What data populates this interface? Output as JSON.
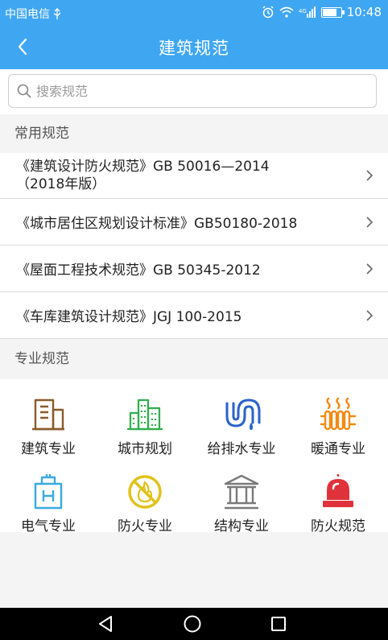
{
  "status": {
    "carrier": "中国电信",
    "time": "10:48"
  },
  "nav": {
    "title": "建筑规范"
  },
  "search": {
    "placeholder": "搜索规范"
  },
  "common": {
    "title": "常用规范",
    "items": [
      {
        "line1": "《建筑设计防火规范》GB 50016—2014",
        "line2": "（2018年版）"
      },
      {
        "line1": "《城市居住区规划设计标准》GB50180-2018"
      },
      {
        "line1": "《屋面工程技术规范》GB 50345-2012"
      },
      {
        "line1": "《车库建筑设计规范》JGJ 100-2015"
      }
    ]
  },
  "professional": {
    "title": "专业规范",
    "items": [
      {
        "label": "建筑专业",
        "icon": "building-icon",
        "color": "#8a5a2b"
      },
      {
        "label": "城市规划",
        "icon": "city-icon",
        "color": "#2fae4a"
      },
      {
        "label": "给排水专业",
        "icon": "water-pipe-icon",
        "color": "#2a62c9"
      },
      {
        "label": "暖通专业",
        "icon": "heater-icon",
        "color": "#f08a12"
      },
      {
        "label": "电气专业",
        "icon": "electric-icon",
        "color": "#3aa9e0"
      },
      {
        "label": "防火专业",
        "icon": "no-fire-icon",
        "color": "#e0c21a"
      },
      {
        "label": "结构专业",
        "icon": "pillar-structure-icon",
        "color": "#7a7a7a"
      },
      {
        "label": "防火规范",
        "icon": "alarm-light-icon",
        "color": "#e0323a"
      }
    ]
  }
}
